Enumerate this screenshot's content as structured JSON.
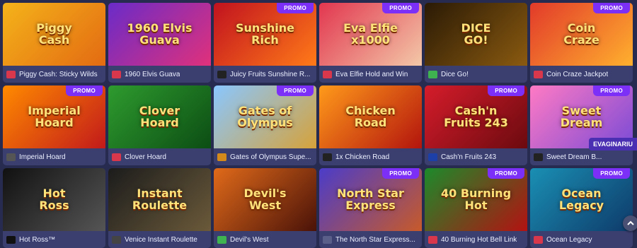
{
  "badge_label": "PROMO",
  "user_tag": "EVAGINARIU",
  "games": [
    {
      "name": "Piggy Cash: Sticky Wilds",
      "art": "Piggy\nCash",
      "promo": false,
      "provider_icon": "red-round-icon",
      "icon_color": "#d9374b",
      "bg": "linear-gradient(135deg,#f4b31a,#e36a12)"
    },
    {
      "name": "1960 Elvis Guava",
      "art": "1960 Elvis\nGuava",
      "promo": false,
      "provider_icon": "shield-icon",
      "icon_color": "#d9374b",
      "bg": "linear-gradient(135deg,#6a2bc8,#e0317b)"
    },
    {
      "name": "Juicy Fruits Sunshine R...",
      "art": "Sunshine\nRich",
      "promo": true,
      "provider_icon": "bbb-icon",
      "icon_color": "#222",
      "bg": "linear-gradient(135deg,#c1121f,#ff7a18)"
    },
    {
      "name": "Eva Elfie Hold and Win",
      "art": "Eva Elfie\nx1000",
      "promo": true,
      "provider_icon": "s-logo-icon",
      "icon_color": "#d9374b",
      "bg": "linear-gradient(135deg,#e2364f,#f3c8a8)"
    },
    {
      "name": "Dice Go!",
      "art": "DICE\nGO!",
      "promo": false,
      "provider_icon": "green-circle-icon",
      "icon_color": "#3fb34f",
      "bg": "linear-gradient(135deg,#2a1a05,#8a5a10)"
    },
    {
      "name": "Coin Craze Jackpot",
      "art": "Coin\nCraze",
      "promo": true,
      "provider_icon": "clover-icon",
      "icon_color": "#d9374b",
      "bg": "linear-gradient(135deg,#e23a2a,#ffb02e)"
    },
    {
      "name": "Imperial Hoard",
      "art": "Imperial\nHoard",
      "promo": true,
      "provider_icon": "gamepad-icon",
      "icon_color": "#555",
      "bg": "linear-gradient(135deg,#ff8a00,#c21a1a)"
    },
    {
      "name": "Clover Hoard",
      "art": "Clover\nHoard",
      "promo": false,
      "provider_icon": "s-logo-icon",
      "icon_color": "#d9374b",
      "bg": "linear-gradient(135deg,#2e9b2e,#0c4d14)"
    },
    {
      "name": "Gates of Olympus Supe...",
      "art": "Gates of\nOlympus",
      "promo": true,
      "provider_icon": "pp-icon",
      "icon_color": "#d48a1a",
      "bg": "linear-gradient(135deg,#8ac7ff,#d6a23a)"
    },
    {
      "name": "1x Chicken Road",
      "art": "Chicken\nRoad",
      "promo": false,
      "provider_icon": "in-icon",
      "icon_color": "#222",
      "bg": "linear-gradient(135deg,#ff9a1a,#b3140d)"
    },
    {
      "name": "Cash'n Fruits 243",
      "art": "Cash'n\nFruits 243",
      "promo": true,
      "provider_icon": "one-icon",
      "icon_color": "#1c3fa8",
      "bg": "linear-gradient(135deg,#d51c2b,#6b0a0f)"
    },
    {
      "name": "Sweet Dream B...",
      "art": "Sweet\nDream",
      "promo": true,
      "provider_icon": "bbb-icon",
      "icon_color": "#222",
      "bg": "linear-gradient(135deg,#ff7ac4,#7b4bd6)"
    },
    {
      "name": "Hot Ross™",
      "art": "Hot\nRoss",
      "promo": false,
      "provider_icon": "h-icon",
      "icon_color": "#111",
      "bg": "linear-gradient(135deg,#111,#555)"
    },
    {
      "name": "Venice Instant Roulette",
      "art": "Instant\nRoulette",
      "promo": false,
      "provider_icon": "infinity-icon",
      "icon_color": "#444",
      "bg": "linear-gradient(135deg,#1c1c1c,#6b5a3a)"
    },
    {
      "name": "Devil's West",
      "art": "Devil's\nWest",
      "promo": false,
      "provider_icon": "green-circle-icon",
      "icon_color": "#3fb34f",
      "bg": "linear-gradient(135deg,#e06a1a,#4a1208)"
    },
    {
      "name": "The North Star Express...",
      "art": "North Star\nExpress",
      "promo": true,
      "provider_icon": "square-icon",
      "icon_color": "#5a5f8a",
      "bg": "linear-gradient(135deg,#4b3cc9,#c75a2a)"
    },
    {
      "name": "40 Burning Hot Bell Link",
      "art": "40 Burning\nHot",
      "promo": true,
      "provider_icon": "ring-icon",
      "icon_color": "#d9374b",
      "bg": "linear-gradient(135deg,#1c8a2a,#b31212)"
    },
    {
      "name": "Ocean Legacy",
      "art": "Ocean\nLegacy",
      "promo": true,
      "provider_icon": "clover-icon",
      "icon_color": "#d9374b",
      "bg": "linear-gradient(135deg,#1a8fb3,#0e3a6a)"
    }
  ]
}
